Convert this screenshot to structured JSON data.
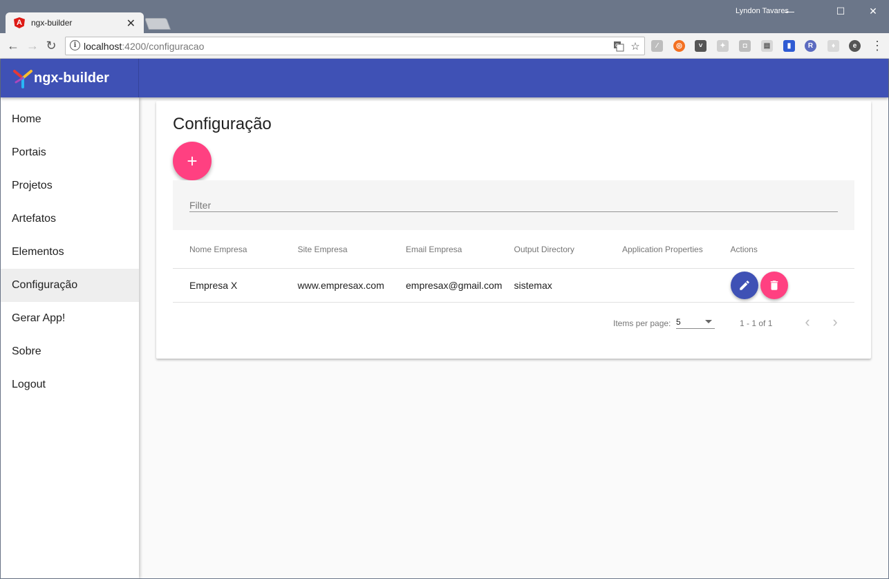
{
  "browser": {
    "tab_title": "ngx-builder",
    "tab_favicon": "A",
    "profile_name": "Lyndon Tavares",
    "url_host": "localhost",
    "url_path": ":4200/configuracao",
    "colors": {
      "frame": "#6b7689",
      "toolbar": "#f2f2f2"
    }
  },
  "app": {
    "brand": "ngx-builder",
    "colors": {
      "primary": "#3f51b5",
      "accent": "#ff4081"
    },
    "sidenav": {
      "items": [
        {
          "label": "Home"
        },
        {
          "label": "Portais"
        },
        {
          "label": "Projetos"
        },
        {
          "label": "Artefatos"
        },
        {
          "label": "Elementos"
        },
        {
          "label": "Configuração",
          "active": true
        },
        {
          "label": "Gerar App!"
        },
        {
          "label": "Sobre"
        },
        {
          "label": "Logout"
        }
      ]
    },
    "page": {
      "title": "Configuração",
      "add_button": "+",
      "filter_placeholder": "Filter",
      "table": {
        "columns": [
          "Nome Empresa",
          "Site Empresa",
          "Email Empresa",
          "Output Directory",
          "Application Properties",
          "Actions"
        ],
        "rows": [
          {
            "nome": "Empresa X",
            "site": "www.empresax.com",
            "email": "empresax@gmail.com",
            "output": "sistemax",
            "properties": ""
          }
        ]
      },
      "paginator": {
        "items_per_page_label": "Items per page:",
        "page_size": "5",
        "range": "1 - 1 of 1"
      }
    }
  }
}
